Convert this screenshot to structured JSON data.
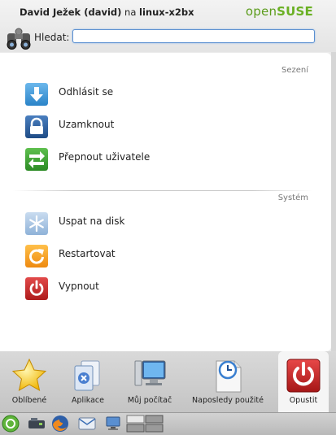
{
  "header": {
    "user_name": "David Ježek (david)",
    "on_word": "na",
    "host": "linux-x2bx",
    "brand_open": "open",
    "brand_suse": "SUSE",
    "search_label": "Hledat:",
    "search_value": ""
  },
  "sections": {
    "session": "Sezení",
    "system": "Systém"
  },
  "session_items": [
    {
      "label": "Odhlásit se",
      "icon": "logout-arrow-down-icon",
      "color": "#3f9ad9"
    },
    {
      "label": "Uzamknout",
      "icon": "lock-icon",
      "color": "#2b5d96"
    },
    {
      "label": "Přepnout uživatele",
      "icon": "switch-user-arrows-icon",
      "color": "#3a9b30"
    }
  ],
  "system_items": [
    {
      "label": "Uspat na disk",
      "icon": "snowflake-icon",
      "color": "#9fc1e6"
    },
    {
      "label": "Restartovat",
      "icon": "restart-icon",
      "color": "#f39a1c"
    },
    {
      "label": "Vypnout",
      "icon": "power-icon",
      "color": "#c92a2a"
    }
  ],
  "tabs": [
    {
      "label": "Oblíbené",
      "icon": "star-icon"
    },
    {
      "label": "Aplikace",
      "icon": "applications-icon"
    },
    {
      "label": "Můj počítač",
      "icon": "computer-icon"
    },
    {
      "label": "Naposledy použité",
      "icon": "recent-documents-icon"
    },
    {
      "label": "Opustit",
      "icon": "leave-power-icon",
      "active": true
    }
  ],
  "panel_icons": [
    "kickoff-menu-icon",
    "device-notifier-icon",
    "firefox-icon",
    "kmail-icon",
    "network-icon",
    "pager-icon"
  ],
  "colors": {
    "accent": "#6ab023",
    "search_border": "#5a8fd0"
  }
}
